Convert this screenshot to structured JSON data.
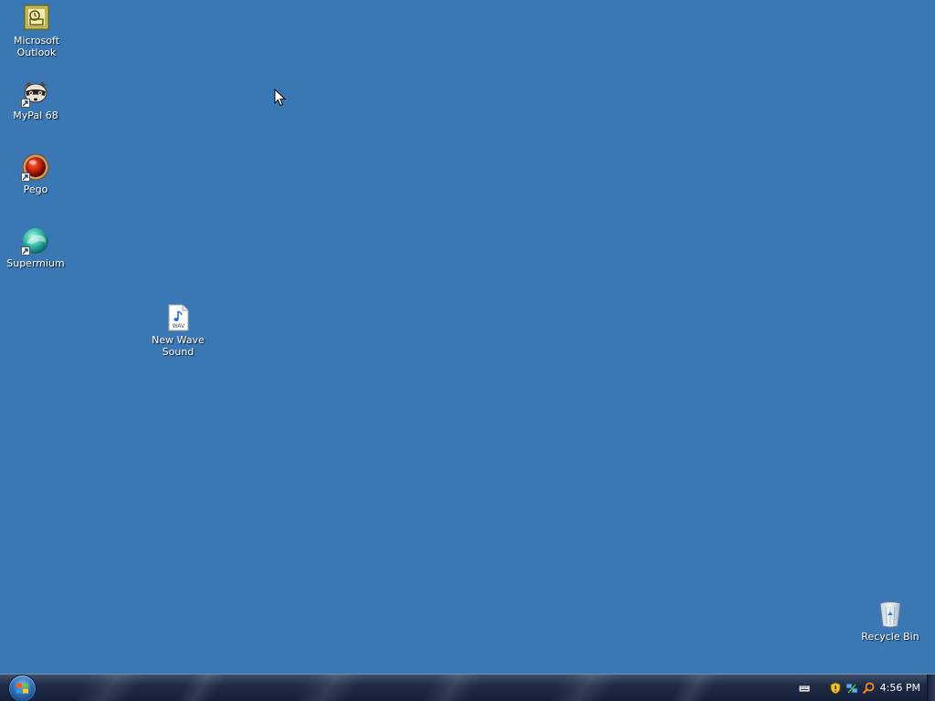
{
  "desktop": {
    "background_color": "#3a78b5",
    "icons": [
      {
        "id": "outlook",
        "label": "Microsoft\nOutlook",
        "icon": "outlook-icon"
      },
      {
        "id": "mypal",
        "label": "MyPal 68",
        "icon": "mypal-raccoon-icon"
      },
      {
        "id": "pego",
        "label": "Pego",
        "icon": "pego-ball-icon"
      },
      {
        "id": "supermium",
        "label": "Supermium",
        "icon": "supermium-icon"
      },
      {
        "id": "wave",
        "label": "New Wave\nSound",
        "icon": "wav-file-icon",
        "badge": "WAV"
      },
      {
        "id": "recycle",
        "label": "Recycle Bin",
        "icon": "recycle-bin-icon"
      }
    ]
  },
  "taskbar": {
    "start_button": "windows-orb-icon",
    "tray_icons": [
      "keyboard-icon",
      "security-shield-icon",
      "network-icon",
      "search-icon"
    ],
    "clock": "4:56 PM"
  }
}
